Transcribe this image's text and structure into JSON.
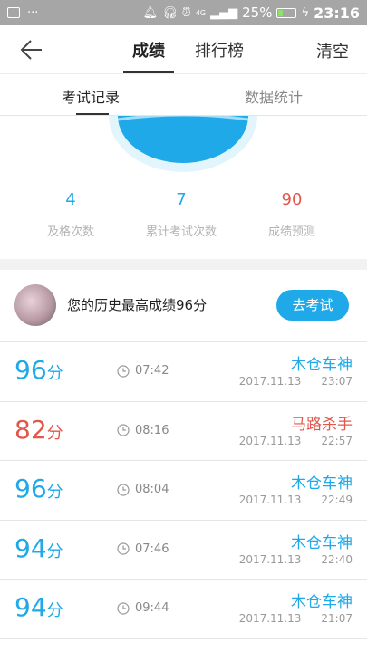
{
  "status": {
    "battery": "25%",
    "time": "23:16",
    "network": "4G"
  },
  "header": {
    "tabs": [
      "成绩",
      "排行榜"
    ],
    "active_tab": "成绩",
    "clear_label": "清空"
  },
  "subtabs": {
    "items": [
      "考试记录",
      "数据统计"
    ],
    "active": "考试记录"
  },
  "stats": [
    {
      "value": "4",
      "label": "及格次数",
      "color": "#1fa9e8"
    },
    {
      "value": "7",
      "label": "累计考试次数",
      "color": "#1fa9e8"
    },
    {
      "value": "90",
      "label": "成绩预测",
      "color": "#e2574c"
    }
  ],
  "best": {
    "text": "您的历史最高成绩96分",
    "button": "去考试"
  },
  "records": [
    {
      "score": "96",
      "unit": "分",
      "duration": "07:42",
      "title": "木仓车神",
      "date": "2017.11.13",
      "time": "23:07",
      "color": "#1fa9e8"
    },
    {
      "score": "82",
      "unit": "分",
      "duration": "08:16",
      "title": "马路杀手",
      "date": "2017.11.13",
      "time": "22:57",
      "color": "#e2574c"
    },
    {
      "score": "96",
      "unit": "分",
      "duration": "08:04",
      "title": "木仓车神",
      "date": "2017.11.13",
      "time": "22:49",
      "color": "#1fa9e8"
    },
    {
      "score": "94",
      "unit": "分",
      "duration": "07:46",
      "title": "木仓车神",
      "date": "2017.11.13",
      "time": "22:40",
      "color": "#1fa9e8"
    },
    {
      "score": "94",
      "unit": "分",
      "duration": "09:44",
      "title": "木仓车神",
      "date": "2017.11.13",
      "time": "21:07",
      "color": "#1fa9e8"
    }
  ],
  "colors": {
    "accent": "#1fa9e8",
    "fail": "#e2574c"
  }
}
